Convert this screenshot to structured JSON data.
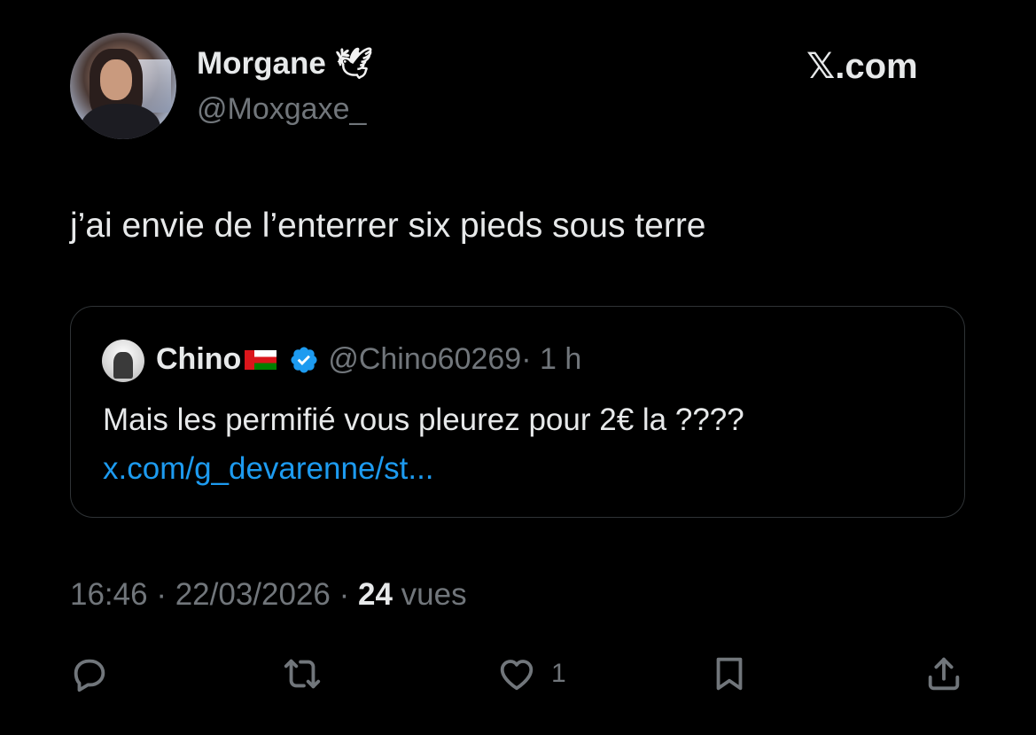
{
  "header": {
    "display_name": "Morgane",
    "name_emoji": "🕊",
    "handle": "@Moxgaxe_",
    "brand": "𝕏.com"
  },
  "tweet": {
    "text": "j’ai envie de l’enterrer six pieds sous terre"
  },
  "quote": {
    "name": "Chino",
    "handle": "@Chino60269",
    "time": "· 1 h",
    "text": "Mais les permifié vous pleurez pour 2€ la ????",
    "link": "x.com/g_devarenne/st..."
  },
  "meta": {
    "time": "16:46",
    "sep1": " · ",
    "date": "22/03/2026",
    "sep2": " · ",
    "views_count": "24",
    "views_label": " vues"
  },
  "actions": {
    "like_count": "1",
    "icons": [
      "reply-icon",
      "retweet-icon",
      "like-icon",
      "bookmark-icon",
      "share-icon"
    ]
  },
  "colors": {
    "background": "#000000",
    "text_primary": "#e7e9ea",
    "text_secondary": "#71767b",
    "link": "#1d9bf0",
    "border": "#2f3336"
  }
}
